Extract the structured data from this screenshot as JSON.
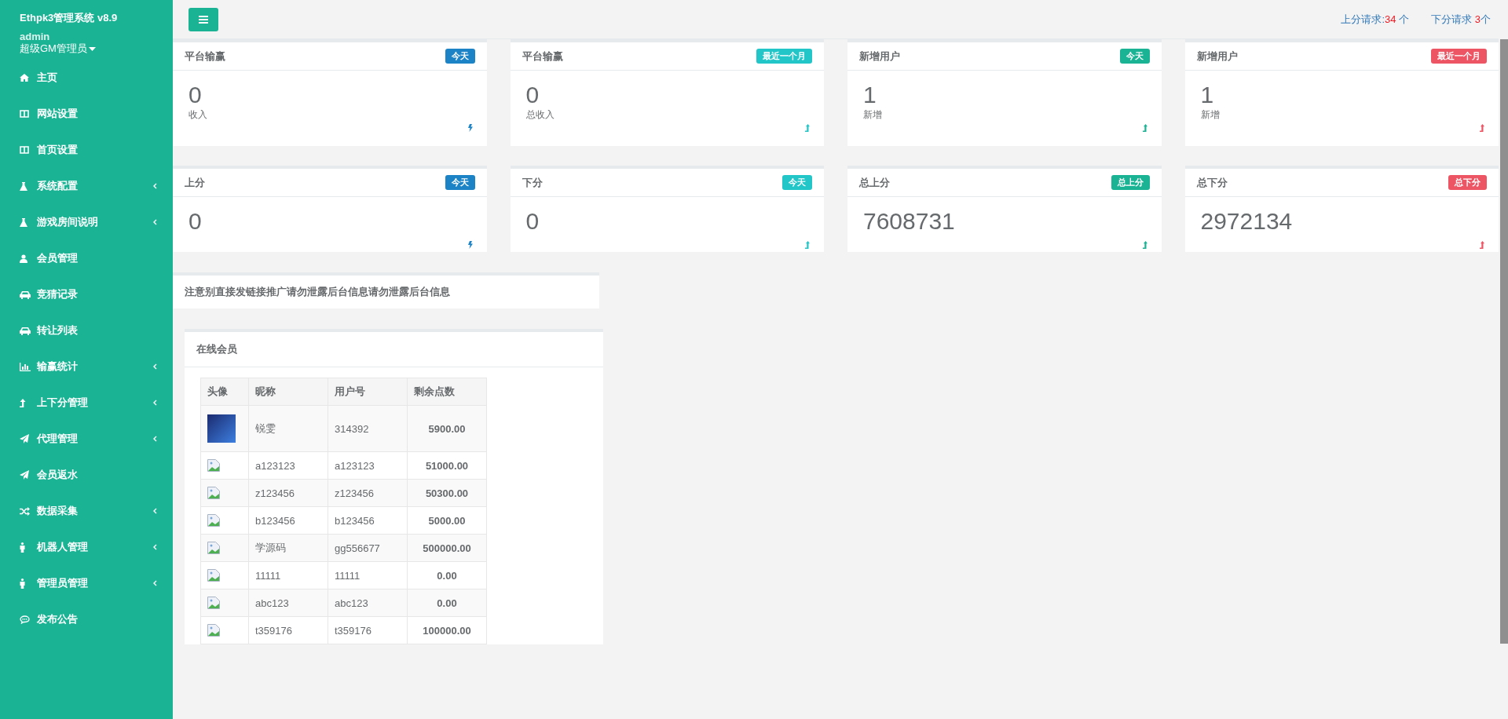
{
  "sidebar": {
    "title": "Ethpk3管理系统 v8.9",
    "user": "admin",
    "role": "超级GM管理员",
    "items": [
      {
        "label": "主页",
        "kind": "home",
        "collapsible": false
      },
      {
        "label": "网站设置",
        "kind": "columns",
        "collapsible": false
      },
      {
        "label": "首页设置",
        "kind": "columns",
        "collapsible": false
      },
      {
        "label": "系统配置",
        "kind": "flask",
        "collapsible": true
      },
      {
        "label": "游戏房间说明",
        "kind": "flask",
        "collapsible": true
      },
      {
        "label": "会员管理",
        "kind": "user",
        "collapsible": false
      },
      {
        "label": "竞猜记录",
        "kind": "car",
        "collapsible": false
      },
      {
        "label": "转让列表",
        "kind": "car",
        "collapsible": false
      },
      {
        "label": "输赢统计",
        "kind": "chart",
        "collapsible": true
      },
      {
        "label": "上下分管理",
        "kind": "levelup",
        "collapsible": true
      },
      {
        "label": "代理管理",
        "kind": "plane",
        "collapsible": true
      },
      {
        "label": "会员返水",
        "kind": "plane",
        "collapsible": false
      },
      {
        "label": "数据采集",
        "kind": "shuffle",
        "collapsible": true
      },
      {
        "label": "机器人管理",
        "kind": "person",
        "collapsible": true
      },
      {
        "label": "管理员管理",
        "kind": "person",
        "collapsible": true
      },
      {
        "label": "发布公告",
        "kind": "comment",
        "collapsible": false
      }
    ]
  },
  "topbar": {
    "requests": [
      {
        "label": "上分请求:",
        "count": "34",
        "unit": " 个"
      },
      {
        "label": "下分请求 ",
        "count": "3",
        "unit": "个"
      }
    ]
  },
  "cards": [
    {
      "title": "平台输赢",
      "badge": "今天",
      "color": "#1c84c6",
      "value": "0",
      "caption": "收入",
      "kind": "bolt"
    },
    {
      "title": "平台输赢",
      "badge": "最近一个月",
      "color": "#23c6c8",
      "value": "0",
      "caption": "总收入",
      "kind": "arrow"
    },
    {
      "title": "新增用户",
      "badge": "今天",
      "color": "#1ab394",
      "value": "1",
      "caption": "新增",
      "kind": "arrow"
    },
    {
      "title": "新增用户",
      "badge": "最近一个月",
      "color": "#ed5565",
      "value": "1",
      "caption": "新增",
      "kind": "arrow"
    },
    {
      "title": "上分",
      "badge": "今天",
      "color": "#1c84c6",
      "value": "0",
      "kind": "bolt"
    },
    {
      "title": "下分",
      "badge": "今天",
      "color": "#23c6c8",
      "value": "0",
      "kind": "arrow"
    },
    {
      "title": "总上分",
      "badge": "总上分",
      "color": "#1ab394",
      "value": "7608731",
      "kind": "arrow"
    },
    {
      "title": "总下分",
      "badge": "总下分",
      "color": "#ed5565",
      "value": "2972134",
      "kind": "arrow"
    }
  ],
  "notice": "注意别直接发链接推广请勿泄露后台信息请勿泄露后台信息",
  "members": {
    "title": "在线会员",
    "columns": [
      "头像",
      "昵称",
      "用户号",
      "剩余点数"
    ],
    "rows": [
      {
        "kind": "photo",
        "nickname": "锐雯",
        "user_id": "314392",
        "points": "5900.00"
      },
      {
        "kind": "broken",
        "nickname": "a123123",
        "user_id": "a123123",
        "points": "51000.00"
      },
      {
        "kind": "broken",
        "nickname": "z123456",
        "user_id": "z123456",
        "points": "50300.00"
      },
      {
        "kind": "broken",
        "nickname": "b123456",
        "user_id": "b123456",
        "points": "5000.00"
      },
      {
        "kind": "broken",
        "nickname": "学源码",
        "user_id": "gg556677",
        "points": "500000.00"
      },
      {
        "kind": "broken",
        "nickname": "11111",
        "user_id": "11111",
        "points": "0.00"
      },
      {
        "kind": "broken",
        "nickname": "abc123",
        "user_id": "abc123",
        "points": "0.00"
      },
      {
        "kind": "broken",
        "nickname": "t359176",
        "user_id": "t359176",
        "points": "100000.00"
      }
    ]
  }
}
